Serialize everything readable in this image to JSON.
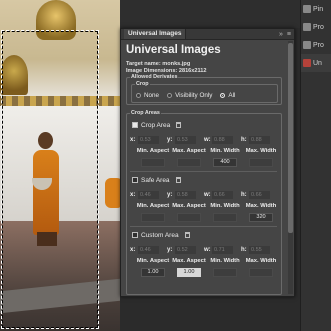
{
  "dock": {
    "items": [
      {
        "label": "Pin",
        "active": false
      },
      {
        "label": "Pro",
        "active": false
      },
      {
        "label": "Pro",
        "active": false
      },
      {
        "label": "Un",
        "active": true
      }
    ]
  },
  "panel": {
    "tab_label": "Universal Images",
    "collapse_glyph": "»",
    "menu_glyph": "≡",
    "title": "Universal Images",
    "target_name": "Target name: monks.jpg",
    "dimensions": "Image Dimensions: 2816x2112",
    "allowed_derivates": {
      "legend": "Allowed Derivates",
      "crop": {
        "legend": "Crop",
        "options": [
          {
            "label": "None",
            "checked": false
          },
          {
            "label": "Visibility Only",
            "checked": false
          },
          {
            "label": "All",
            "checked": true
          }
        ]
      }
    },
    "crop_areas": {
      "legend": "Crop Areas",
      "areas": [
        {
          "name": "Crop Area",
          "checked": true,
          "x": "0.53",
          "y": "0.53",
          "w": "0.88",
          "h": "0.88",
          "labels": [
            "Min. Aspect",
            "Max. Aspect",
            "Min. Width",
            "Max. Width"
          ],
          "values": [
            "",
            "",
            "400",
            ""
          ]
        },
        {
          "name": "Safe Area",
          "checked": false,
          "x": "0.46",
          "y": "0.58",
          "w": "0.66",
          "h": "0.66",
          "labels": [
            "Min. Aspect",
            "Max. Aspect",
            "Min. Width",
            "Max. Width"
          ],
          "values": [
            "",
            "",
            "",
            "320"
          ]
        },
        {
          "name": "Custom Area",
          "checked": false,
          "x": "0.46",
          "y": "0.52",
          "w": "0.71",
          "h": "0.55",
          "labels": [
            "Min. Aspect",
            "Max. Aspect",
            "Min. Width",
            "Max. Width"
          ],
          "values": [
            "1.00",
            "1.00",
            "",
            ""
          ]
        }
      ]
    }
  }
}
